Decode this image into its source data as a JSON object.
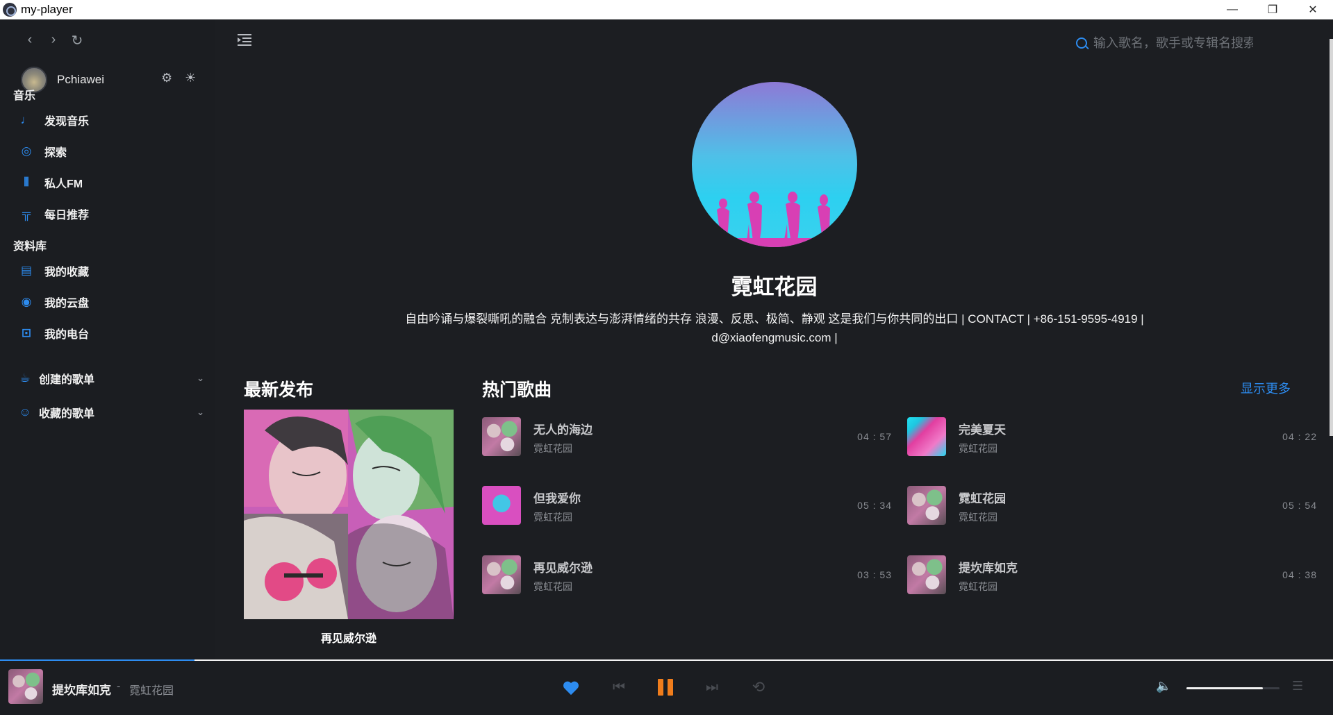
{
  "window": {
    "title": "my-player",
    "minimize": "—",
    "maximize": "❐",
    "close": "✕"
  },
  "nav": {
    "back": "‹",
    "forward": "›",
    "refresh": "↻"
  },
  "user": {
    "name": "Pchiawei"
  },
  "sidebar": {
    "music_title": "音乐",
    "music_items": [
      {
        "label": "发现音乐",
        "icon": "music-note-icon",
        "glyph": "♩"
      },
      {
        "label": "探索",
        "icon": "compass-icon",
        "glyph": "◎"
      },
      {
        "label": "私人FM",
        "icon": "radio-wave-icon",
        "glyph": "⦀"
      },
      {
        "label": "每日推荐",
        "icon": "calendar-icon",
        "glyph": "╦"
      }
    ],
    "library_title": "资料库",
    "library_items": [
      {
        "label": "我的收藏",
        "icon": "collection-icon",
        "glyph": "▤"
      },
      {
        "label": "我的云盘",
        "icon": "cloud-disk-icon",
        "glyph": "◉"
      },
      {
        "label": "我的电台",
        "icon": "radio-station-icon",
        "glyph": "⊡"
      }
    ],
    "playlists": [
      {
        "label": "创建的歌单",
        "icon": "cup-icon",
        "glyph": "☕"
      },
      {
        "label": "收藏的歌单",
        "icon": "smile-icon",
        "glyph": "☺"
      }
    ]
  },
  "search": {
    "placeholder": "输入歌名，歌手或专辑名搜索"
  },
  "artist": {
    "name": "霓虹花园",
    "description_line1": "自由吟诵与爆裂嘶吼的融合 克制表达与澎湃情绪的共存 浪漫、反思、极简、静观 这是我们与你共同的出口 | CONTACT | +86-151-9595-4919 |",
    "description_line2": "d@xiaofengmusic.com |"
  },
  "latest": {
    "heading": "最新发布",
    "album_title": "再见威尔逊"
  },
  "hot": {
    "heading": "热门歌曲",
    "show_more": "显示更多",
    "songs": [
      {
        "name": "无人的海边",
        "artist": "霓虹花园",
        "duration": "04 : 57",
        "art": "collage"
      },
      {
        "name": "完美夏天",
        "artist": "霓虹花园",
        "duration": "04 : 22",
        "art": "cyan"
      },
      {
        "name": "但我爱你",
        "artist": "霓虹花园",
        "duration": "05 : 34",
        "art": "pink"
      },
      {
        "name": "霓虹花园",
        "artist": "霓虹花园",
        "duration": "05 : 54",
        "art": "collage"
      },
      {
        "name": "再见威尔逊",
        "artist": "霓虹花园",
        "duration": "03 : 53",
        "art": "collage"
      },
      {
        "name": "提坎库如克",
        "artist": "霓虹花园",
        "duration": "04 : 38",
        "art": "collage"
      }
    ]
  },
  "player": {
    "title": "提坎库如克",
    "separator": "-",
    "artist": "霓虹花园",
    "progress_fraction": 0.146,
    "volume_fraction": 0.82,
    "liked": true,
    "state": "playing",
    "colors": {
      "accent": "#2d8cf0",
      "pause": "#f07d1c"
    }
  }
}
